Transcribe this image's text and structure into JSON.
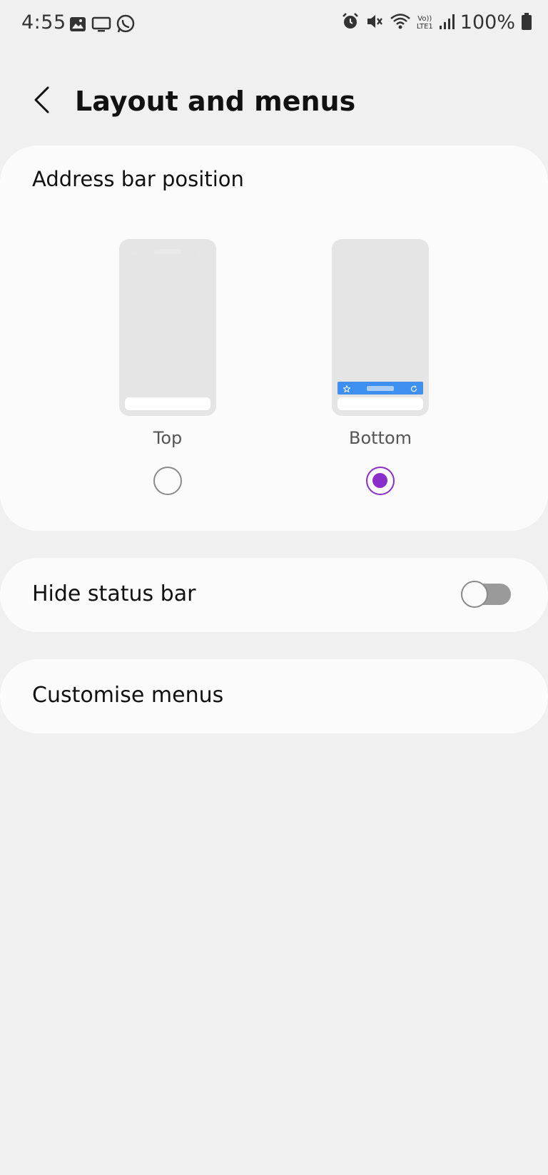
{
  "status_bar": {
    "time": "4:55",
    "left_icons": [
      "gallery-icon",
      "cast-screen-icon",
      "whatsapp-icon"
    ],
    "right_icons": [
      "alarm-icon",
      "mute-icon",
      "wifi-icon",
      "volte-icon",
      "signal-icon"
    ],
    "volte_top": "Vo))",
    "volte_bottom": "LTE1",
    "battery_text": "100%",
    "battery_icon": "battery-icon"
  },
  "header": {
    "back_icon": "back-arrow-icon",
    "title": "Layout and menus"
  },
  "address_bar": {
    "title": "Address bar position",
    "options": [
      {
        "label": "Top",
        "selected": false,
        "bar_color": "#c4c4c4",
        "bar_mid_color": "#e8e8e8",
        "bar_icon_color": "#e8e8e8"
      },
      {
        "label": "Bottom",
        "selected": true,
        "bar_color": "#3d8ff0",
        "bar_mid_color": "#a9cdf7",
        "bar_icon_color": "#ffffff"
      }
    ],
    "accent_color": "#8a2ec9"
  },
  "hide_status_bar": {
    "label": "Hide status bar",
    "enabled": false
  },
  "customise_menus": {
    "label": "Customise menus"
  }
}
